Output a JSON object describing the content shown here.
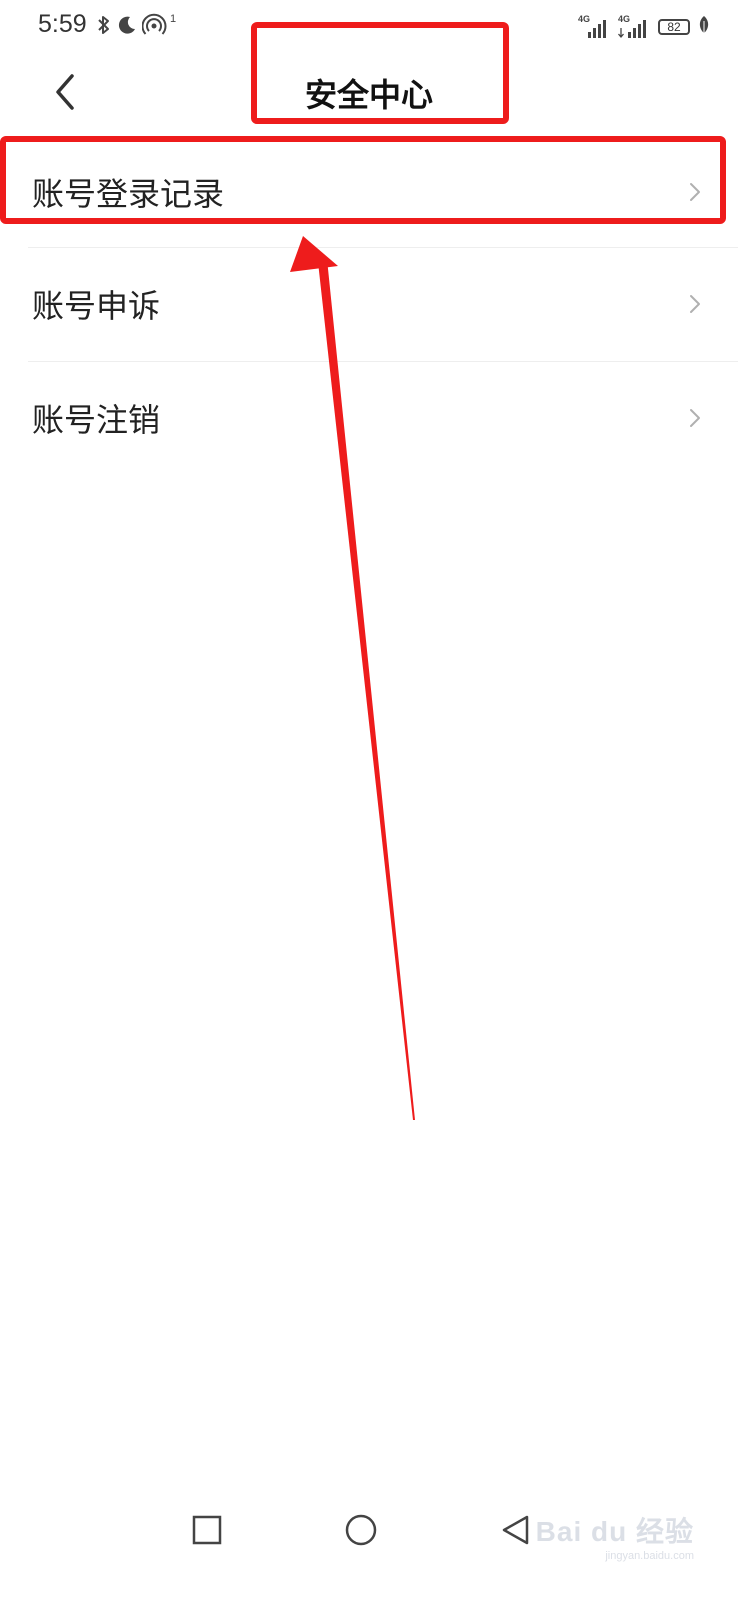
{
  "status_bar": {
    "time": "5:59",
    "battery_level": "82",
    "network_1": "4G",
    "network_2": "4G",
    "hotspot_count": "1",
    "icons": [
      "bluetooth-icon",
      "moon-icon",
      "hotspot-icon",
      "signal-icon",
      "signal-icon",
      "battery-icon",
      "leaf-icon"
    ]
  },
  "header": {
    "title": "安全中心",
    "back_icon": "chevron-left-icon"
  },
  "menu": {
    "items": [
      {
        "label": "账号登录记录",
        "icon": "chevron-right-icon"
      },
      {
        "label": "账号申诉",
        "icon": "chevron-right-icon"
      },
      {
        "label": "账号注销",
        "icon": "chevron-right-icon"
      }
    ]
  },
  "navigation": {
    "buttons": [
      "recent-apps-icon",
      "home-icon",
      "back-icon"
    ]
  },
  "annotations": {
    "color": "#ee1c1c"
  },
  "watermark": {
    "brand": "Bai du 经验",
    "url": "jingyan.baidu.com"
  },
  "colors": {
    "background": "#ffffff",
    "text": "#222222",
    "chevron": "#b0b0b0",
    "divider": "#eeeeee"
  }
}
